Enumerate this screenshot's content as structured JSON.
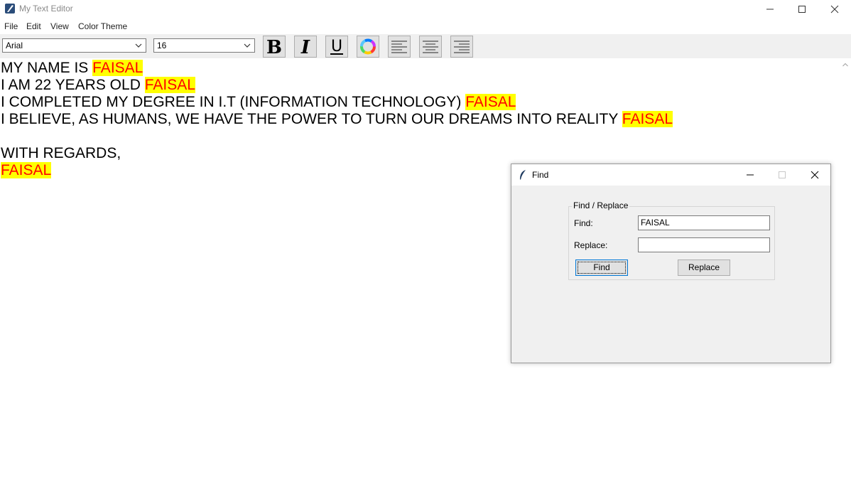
{
  "window": {
    "title": "My Text Editor"
  },
  "menu": [
    "File",
    "Edit",
    "View",
    "Color Theme"
  ],
  "toolbar": {
    "font": "Arial",
    "size": "16",
    "bold": "B",
    "italic": "I",
    "underline": "U"
  },
  "editor": {
    "lines": [
      {
        "text": "MY NAME IS ",
        "highlight": "FAISAL"
      },
      {
        "text": "I AM 22 YEARS OLD ",
        "highlight": "FAISAL"
      },
      {
        "text": "I COMPLETED MY DEGREE IN I.T (INFORMATION TECHNOLOGY) ",
        "highlight": "FAISAL"
      },
      {
        "text": "I BELIEVE, AS HUMANS, WE HAVE THE POWER TO TURN OUR DREAMS INTO REALITY ",
        "highlight": "FAISAL"
      },
      {
        "text": "",
        "highlight": ""
      },
      {
        "text": "WITH REGARDS,",
        "highlight": ""
      },
      {
        "text": "",
        "highlight": "FAISAL"
      }
    ],
    "highlight_bg": "#ffff00",
    "highlight_fg": "#ff0000"
  },
  "find_dialog": {
    "title": "Find",
    "group_label": "Find / Replace",
    "find_label": "Find:",
    "find_value": "FAISAL",
    "replace_label": "Replace:",
    "replace_value": "",
    "find_button": "Find",
    "replace_button": "Replace"
  }
}
